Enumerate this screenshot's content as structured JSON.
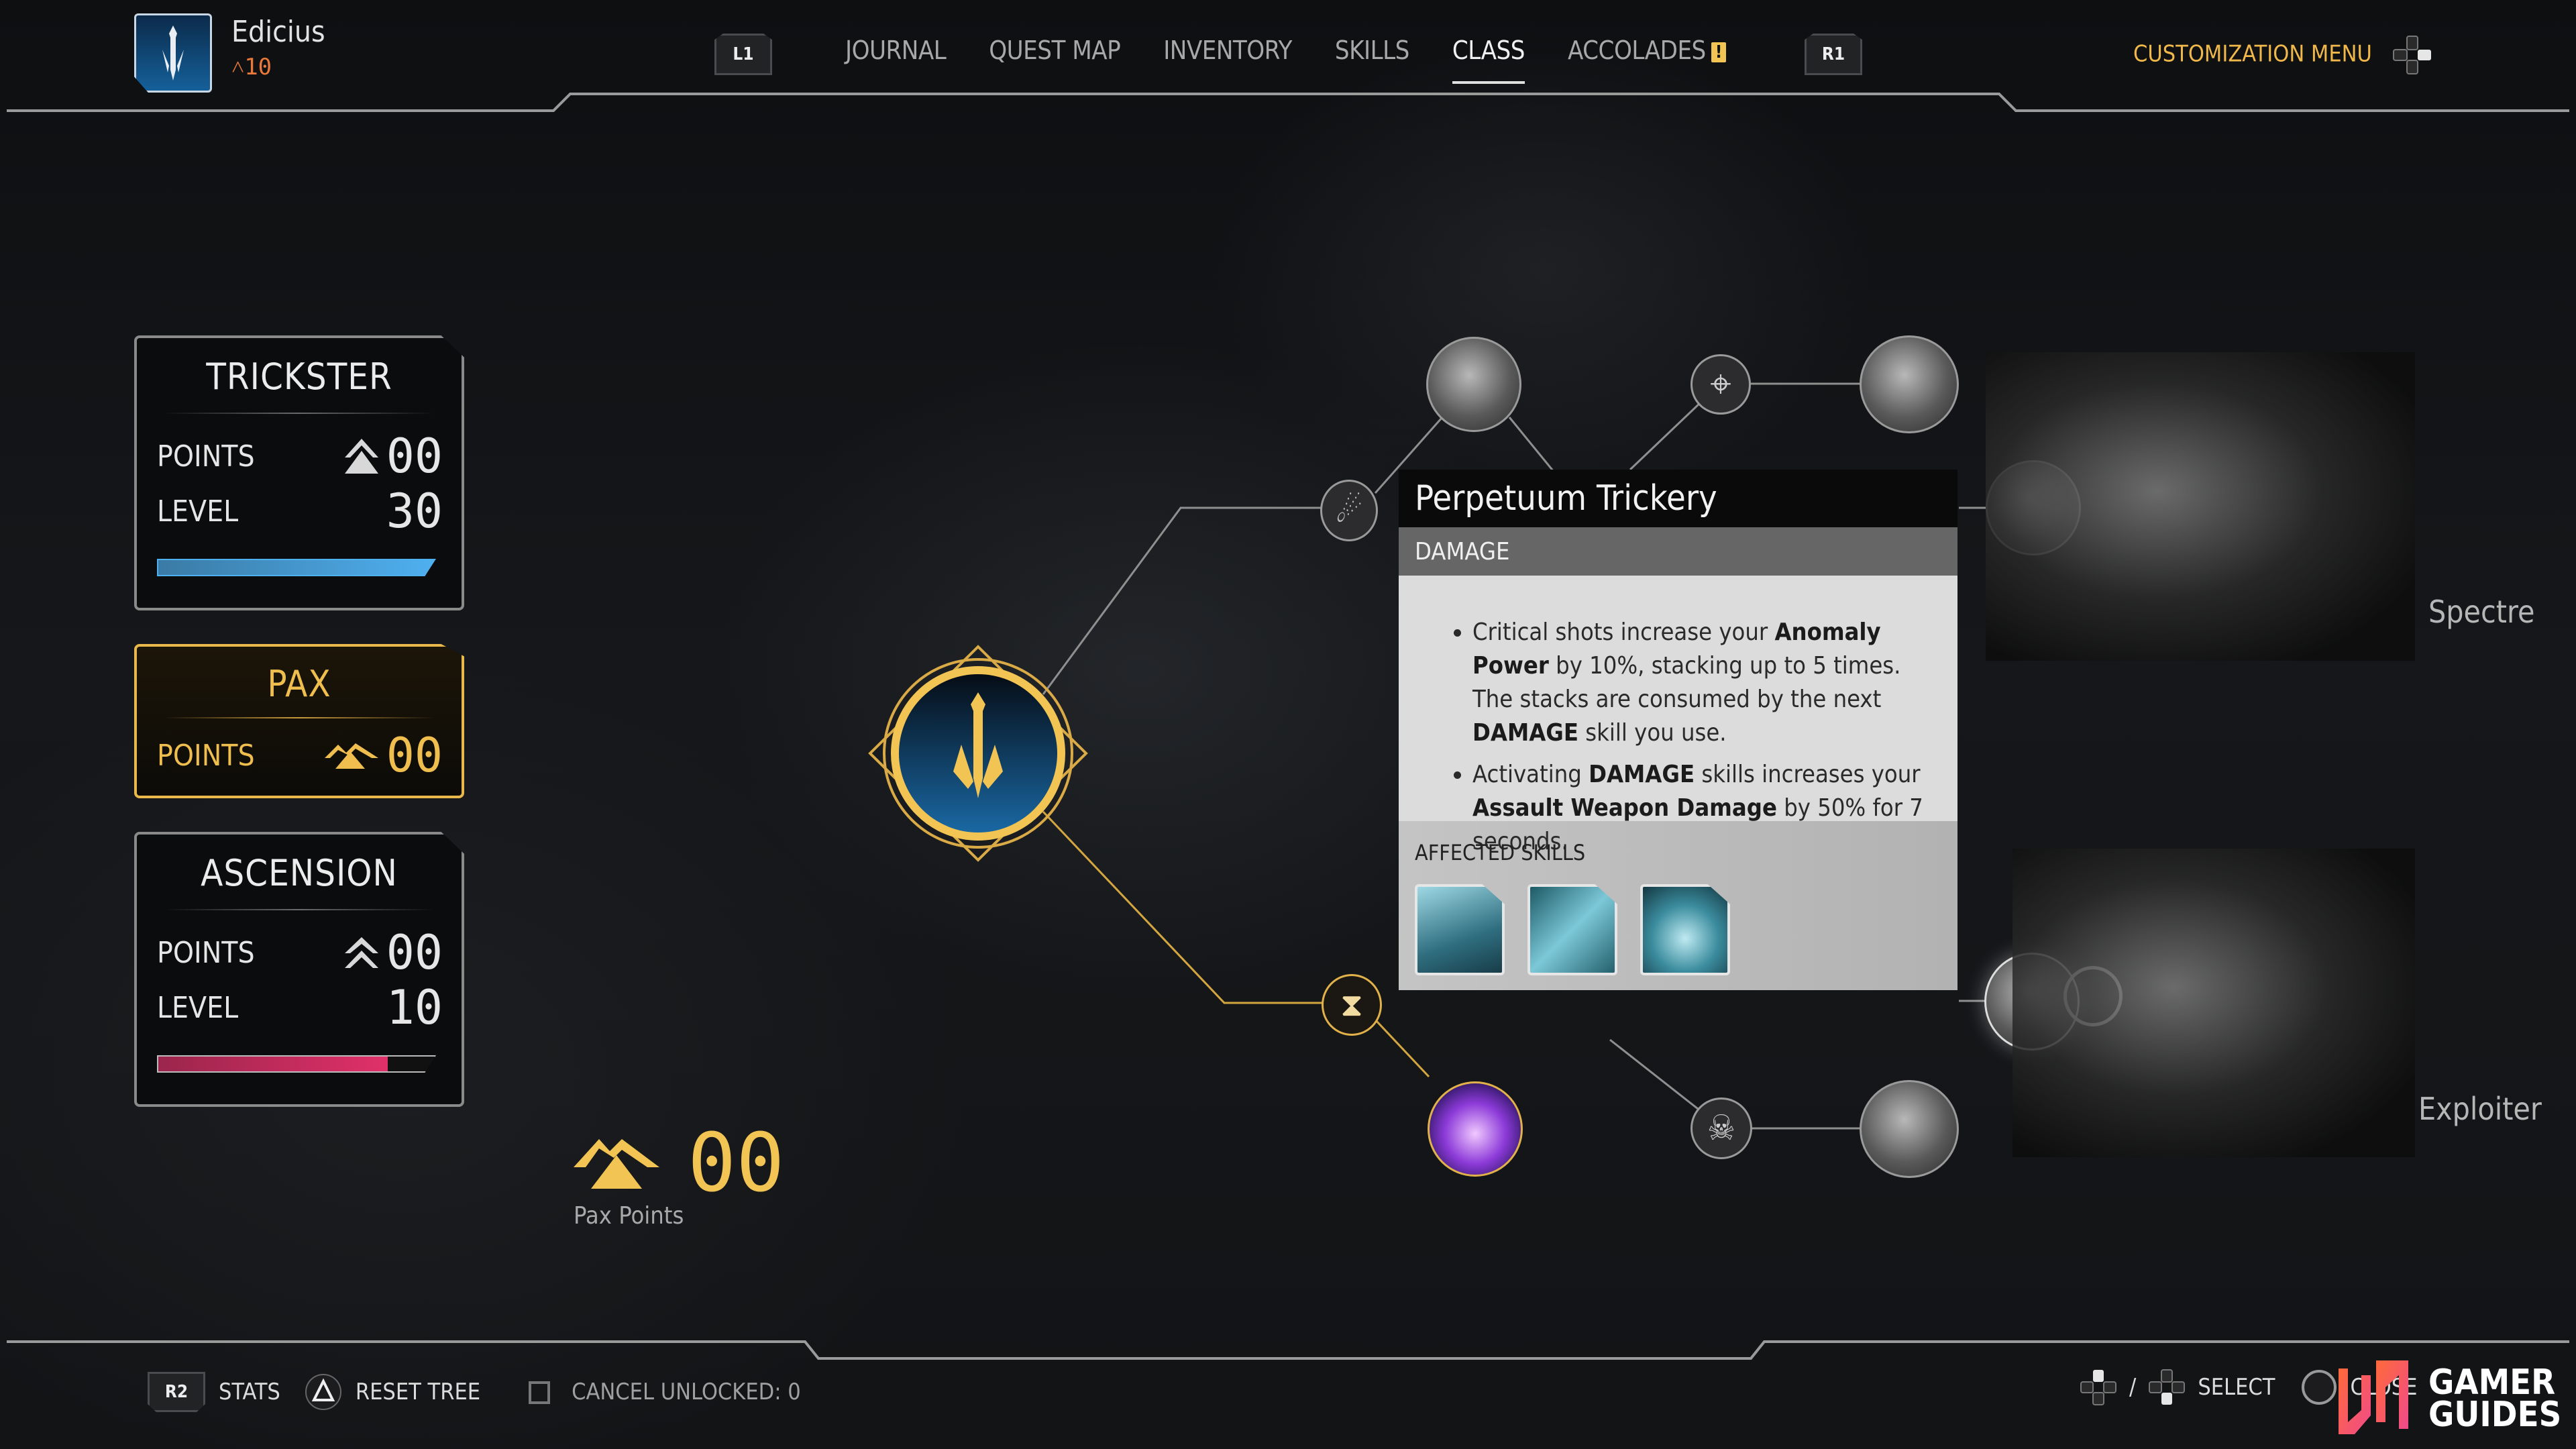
{
  "header": {
    "character_name": "Edicius",
    "character_level": "10",
    "left_bumper": "L1",
    "right_bumper": "R1",
    "tabs": [
      {
        "label": "JOURNAL",
        "active": false
      },
      {
        "label": "QUEST MAP",
        "active": false
      },
      {
        "label": "INVENTORY",
        "active": false
      },
      {
        "label": "SKILLS",
        "active": false
      },
      {
        "label": "CLASS",
        "active": true
      },
      {
        "label": "ACCOLADES",
        "active": false,
        "badge": "!"
      }
    ],
    "customization_label": "CUSTOMIZATION MENU"
  },
  "cards": {
    "trickster": {
      "title": "TRICKSTER",
      "points_label": "POINTS",
      "points": "00",
      "level_label": "LEVEL",
      "level": "30",
      "progress": 1.0,
      "bar_color": "#4fb0f0"
    },
    "pax": {
      "title": "PAX",
      "points_label": "POINTS",
      "points": "00"
    },
    "ascension": {
      "title": "ASCENSION",
      "points_label": "POINTS",
      "points": "00",
      "level_label": "LEVEL",
      "level": "10",
      "progress": 0.83,
      "bar_color": "#e0306a"
    }
  },
  "tree": {
    "root": "pax-sword-emblem",
    "nodes": [
      {
        "name": "dash-burst-node",
        "state": "locked"
      },
      {
        "name": "sprint-portrait-node",
        "state": "locked"
      },
      {
        "name": "crosshair-node",
        "state": "locked"
      },
      {
        "name": "duo-portrait-node",
        "state": "locked"
      },
      {
        "name": "anomaly-hand-node",
        "state": "locked"
      },
      {
        "name": "hourglass-fist-node",
        "state": "unlocked"
      },
      {
        "name": "portal-runner-node",
        "state": "unlocked"
      },
      {
        "name": "skull-node",
        "state": "locked"
      },
      {
        "name": "slide-portrait-node",
        "state": "locked"
      },
      {
        "name": "gunner-portrait-node",
        "state": "selected"
      }
    ]
  },
  "tooltip": {
    "title": "Perpetuum Trickery",
    "category": "DAMAGE",
    "bullets": [
      [
        {
          "t": "Critical shots increase your ",
          "b": false
        },
        {
          "t": "Anomaly Power",
          "b": true
        },
        {
          "t": " by 10%, stacking up to 5 times. The stacks are consumed by the next ",
          "b": false
        },
        {
          "t": "DAMAGE",
          "b": true
        },
        {
          "t": " skill you use.",
          "b": false
        }
      ],
      [
        {
          "t": "Activating ",
          "b": false
        },
        {
          "t": "DAMAGE",
          "b": true
        },
        {
          "t": " skills increases your ",
          "b": false
        },
        {
          "t": "Assault Weapon Damage",
          "b": true
        },
        {
          "t": " by 50% for 7 seconds.",
          "b": false
        }
      ]
    ],
    "affected_title": "AFFECTED SKILLS",
    "affected_skills": [
      "skill-ice-slam",
      "skill-ice-bullet",
      "skill-vortex"
    ]
  },
  "subclasses": [
    {
      "label": "Spectre"
    },
    {
      "label": "Exploiter"
    }
  ],
  "pax_summary": {
    "value": "00",
    "label": "Pax Points"
  },
  "footer": {
    "stats_button": "R2",
    "stats_label": "STATS",
    "reset_label": "RESET TREE",
    "cancel_label": "CANCEL UNLOCKED: 0",
    "select_label": "SELECT",
    "close_label": "CLOSE"
  },
  "watermark": {
    "line1": "GAMER",
    "line2": "GUIDES"
  },
  "colors": {
    "gold": "#f1c453",
    "accent_orange": "#e8793a",
    "trickster_blue": "#4fb0f0",
    "ascension_pink": "#e0306a"
  }
}
